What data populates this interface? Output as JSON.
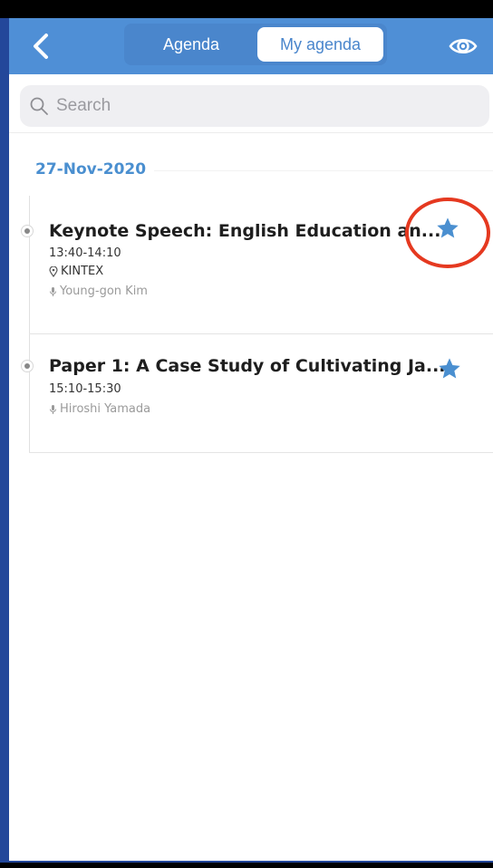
{
  "nav": {
    "back_icon": "chevron-left-icon",
    "tab_agenda": "Agenda",
    "tab_my_agenda": "My agenda",
    "eye_icon": "eye-icon",
    "bar_color": "#4f8fd6"
  },
  "search": {
    "placeholder": "Search"
  },
  "section": {
    "date": "27-Nov-2020"
  },
  "items": [
    {
      "title": "Keynote Speech: English Education an...",
      "time": "13:40-14:10",
      "location": "KINTEX",
      "speaker": "Young-gon Kim",
      "starred": true
    },
    {
      "title": "Paper 1:  A Case Study of Cultivating Ja...",
      "time": "15:10-15:30",
      "speaker": "Hiroshi Yamada",
      "starred": true
    }
  ],
  "colors": {
    "accent": "#4a8fd0",
    "highlight_circle": "#e53920"
  }
}
